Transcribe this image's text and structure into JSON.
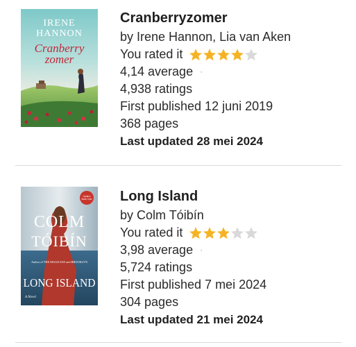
{
  "books": [
    {
      "title": "Cranberryzomer",
      "authors": "by Irene Hannon, Lia van Aken",
      "rated_label": "You rated it",
      "user_rating": 4,
      "max_rating": 5,
      "average": "4,14 average",
      "ratings": "4,938 ratings",
      "first_published": "First published 12 juni 2019",
      "pages": "368 pages",
      "last_updated": "Last updated 28 mei 2024",
      "cover": {
        "author_text_1": "IRENE",
        "author_text_2": "HANNON",
        "title_text_1": "Cranberry",
        "title_text_2": "zomer"
      }
    },
    {
      "title": "Long Island",
      "authors": "by Colm Tóibín",
      "rated_label": "You rated it",
      "user_rating": 3,
      "max_rating": 5,
      "average": "3,98 average",
      "ratings": "5,724 ratings",
      "first_published": "First published 7 mei 2024",
      "pages": "304 pages",
      "last_updated": "Last updated 21 mei 2024",
      "cover": {
        "author_text_1": "COLM",
        "author_text_2": "TÓIBÍN",
        "tagline": "Author of THE MAGICIAN and BROOKLYN",
        "title_text": "LONG ISLAND",
        "subtitle": "A Novel"
      }
    }
  ],
  "average_separator": "·",
  "colors": {
    "star_filled": "#f5b324",
    "star_empty": "#d9d9d9",
    "divider": "#d8d8d8",
    "text": "#222222"
  }
}
